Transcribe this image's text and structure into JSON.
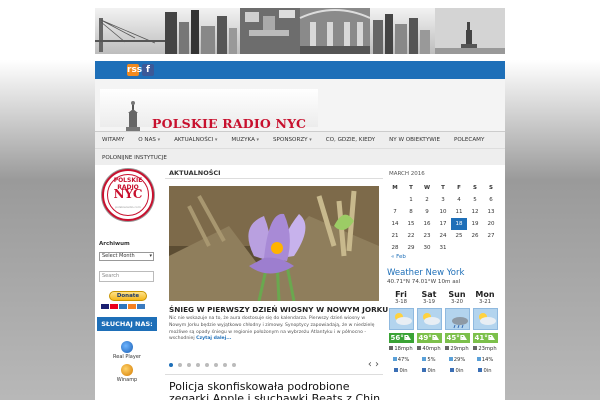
{
  "site": {
    "logo_text": "POLSKIE RADIO NYC",
    "seal": {
      "top": "POLSKIE RADIO",
      "main": "NYC",
      "bottom": "polskieradio.com"
    }
  },
  "social": {
    "rss_label": "rss",
    "facebook_label": "f"
  },
  "nav": {
    "row1": [
      {
        "label": "WITAMY",
        "sub": false
      },
      {
        "label": "O NAS",
        "sub": true
      },
      {
        "label": "AKTUALNOŚCI",
        "sub": true
      },
      {
        "label": "MUZYKA",
        "sub": true
      },
      {
        "label": "SPONSORZY",
        "sub": true
      },
      {
        "label": "CO, GDZIE, KIEDY",
        "sub": false
      },
      {
        "label": "NY W OBIEKTYWIE",
        "sub": false
      },
      {
        "label": "POLECAMY",
        "sub": false
      }
    ],
    "row2": [
      {
        "label": "POLONIJNE INSTYTUCJE",
        "sub": false
      }
    ]
  },
  "left": {
    "archive_label": "Archiwum",
    "archive_select": "Select Month",
    "search_placeholder": "Search",
    "donate_label": "Donate",
    "listen_label": "SŁUCHAJ NAS:",
    "players": [
      "Real Player",
      "Winamp"
    ]
  },
  "main": {
    "section_title": "AKTUALNOŚCI",
    "slide": {
      "headline": "ŚNIEG W PIERWSZY DZIEŃ WIOSNY W NOWYM JORKU",
      "body": "Nic nie wskazuje na to, że aura dostosuje się do kalendarza. Pierwszy dzień wiosny w Nowym Jorku będzie wyjątkowo chłodny i zimowy. Synoptycy zapowiadają, że w niedzielę możliwe są opady śniegu w regionie położonym na wybrzeżu Atlantyku i w północno - wschodniej",
      "more_label": "Czytaj dalej...",
      "dots": 8,
      "active_dot": 0,
      "arrows": "‹ ›"
    },
    "article_headline": "Policja skonfiskowała podrobione zegarki Apple i słuchawki Beats z Chin"
  },
  "calendar": {
    "title": "MARCH 2016",
    "weekdays": [
      "M",
      "T",
      "W",
      "T",
      "F",
      "S",
      "S"
    ],
    "weeks": [
      [
        "",
        "1",
        "2",
        "3",
        "4",
        "5",
        "6"
      ],
      [
        "7",
        "8",
        "9",
        "10",
        "11",
        "12",
        "13"
      ],
      [
        "14",
        "15",
        "16",
        "17",
        "18",
        "19",
        "20"
      ],
      [
        "21",
        "22",
        "23",
        "24",
        "25",
        "26",
        "27"
      ],
      [
        "28",
        "29",
        "30",
        "31",
        "",
        "",
        ""
      ]
    ],
    "today": "18",
    "prev_label": "« Feb"
  },
  "weather": {
    "title": "Weather New York",
    "coords": "40.71°N 74.01°W 10m asl",
    "days": [
      {
        "name": "Fri",
        "date": "3-18",
        "temp": "56",
        "wind": "18",
        "rain": "47",
        "precip": "0",
        "icon": "sun-cloud"
      },
      {
        "name": "Sat",
        "date": "3-19",
        "temp": "49",
        "wind": "40",
        "rain": "5",
        "precip": "0",
        "icon": "sun-cloud"
      },
      {
        "name": "Sun",
        "date": "3-20",
        "temp": "45",
        "wind": "29",
        "rain": "29",
        "precip": "0",
        "icon": "rain-cloud"
      },
      {
        "name": "Mon",
        "date": "3-21",
        "temp": "41",
        "wind": "23",
        "rain": "14",
        "precip": "0",
        "icon": "sun-cloud"
      }
    ],
    "units": {
      "temp": "°F",
      "wind": "mph",
      "rain": "%",
      "precip": "in"
    },
    "colors": {
      "warm": "#3aa335",
      "cool": "#7cc04b"
    }
  }
}
